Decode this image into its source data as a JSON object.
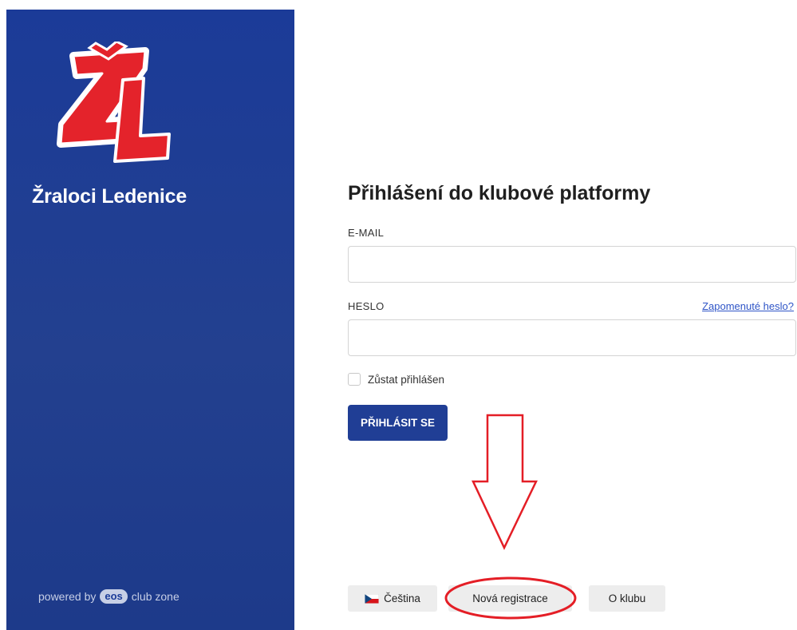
{
  "sidebar": {
    "club_name": "Žraloci Ledenice",
    "powered_prefix": "powered by",
    "powered_badge": "eos",
    "powered_suffix": "club zone",
    "logo_icon": "zl-shark-logo",
    "logo_text": "ŽL",
    "bg_color": "#1b3b98"
  },
  "login": {
    "title": "Přihlášení do klubové platformy",
    "email_label": "E-MAIL",
    "email_value": "",
    "password_label": "HESLO",
    "password_value": "",
    "forgot_link": "Zapomenuté heslo?",
    "remember_label": "Zůstat přihlášen",
    "remember_checked": false,
    "submit_label": "PŘIHLÁSIT SE",
    "accent_color": "#203e95"
  },
  "footer": {
    "language_label": "Čeština",
    "language_icon": "czech-flag-icon",
    "register_label": "Nová registrace",
    "about_label": "O klubu"
  },
  "annotations": {
    "color": "#e41e26",
    "arrow": "down-arrow",
    "circle": "ellipse-around-register"
  }
}
